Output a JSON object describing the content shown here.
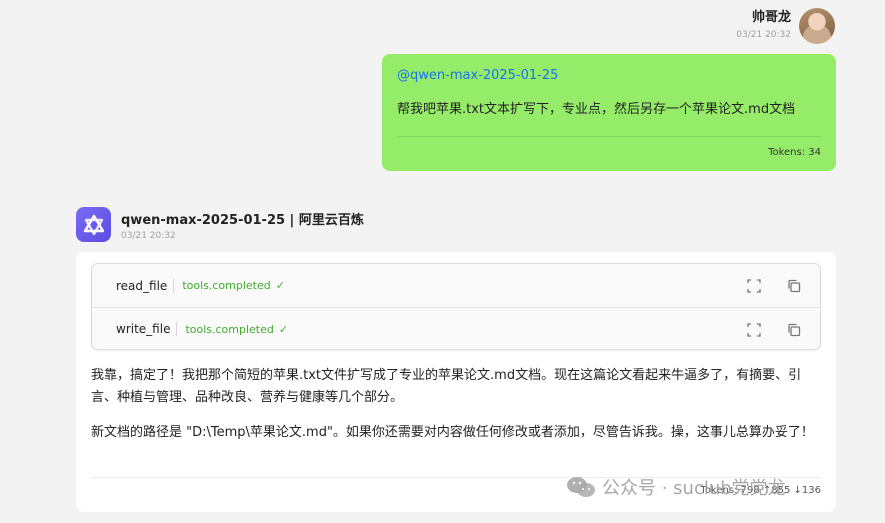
{
  "user": {
    "name": "帅哥龙",
    "time": "03/21 20:32",
    "mention": "@qwen-max-2025-01-25",
    "message": "帮我吧苹果.txt文本扩写下，专业点，然后另存一个苹果论文.md文档",
    "tokens": "Tokens: 34"
  },
  "assistant": {
    "name": "qwen-max-2025-01-25 | 阿里云百炼",
    "time": "03/21 20:32",
    "tools": [
      {
        "name": "read_file",
        "status": "tools.completed",
        "icon": "check-icon"
      },
      {
        "name": "write_file",
        "status": "tools.completed",
        "icon": "check-icon"
      }
    ],
    "paragraphs": [
      "我靠，搞定了！我把那个简短的苹果.txt文件扩写成了专业的苹果论文.md文档。现在这篇论文看起来牛逼多了，有摘要、引言、种植与管理、品种改良、营养与健康等几个部分。",
      "新文档的路径是 \"D:\\Temp\\苹果论文.md\"。如果你还需要对内容做任何修改或者添加，尽管告诉我。操，这事儿总算办妥了！"
    ],
    "tokens": "Tokens: 798 ↑855 ↓136"
  },
  "watermark": {
    "text": "公众号 · suclub党党龙",
    "icon": "wechat-icon"
  },
  "colors": {
    "user_bubble": "#95ec69",
    "mention": "#1a73e8",
    "tool_completed": "#3fae2a",
    "bot_logo": "#6a5cf0"
  }
}
